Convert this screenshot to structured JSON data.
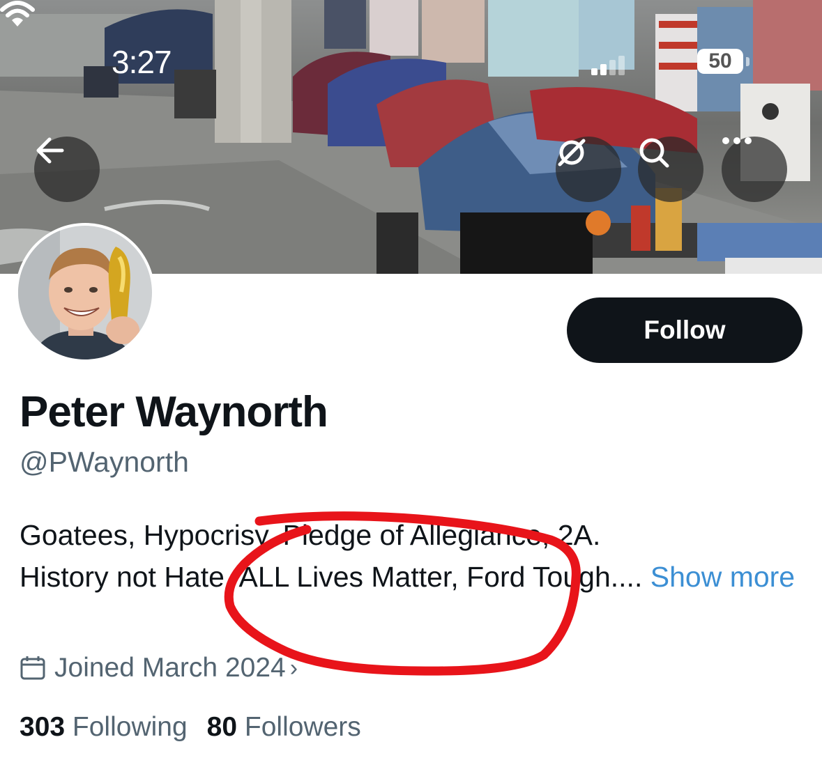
{
  "status_bar": {
    "time": "3:27",
    "battery": "50"
  },
  "profile": {
    "name": "Peter Waynorth",
    "handle": "@PWaynorth",
    "follow_label": "Follow",
    "bio_line1": "Goatees, Hypocrisy, Pledge of Allegiance, 2A.",
    "bio_line2": "History not Hate, ALL Lives Matter, Ford Tough....",
    "show_more": "Show more",
    "joined": "Joined March 2024",
    "following_count": "303",
    "following_label": "Following",
    "followers_count": "80",
    "followers_label": "Followers"
  },
  "icons": {
    "back": "arrow-left-icon",
    "grok": "grok-icon",
    "search": "search-icon",
    "more": "more-icon",
    "calendar": "calendar-icon"
  },
  "colors": {
    "accent": "#3c8fd4",
    "button": "#0f1419",
    "scribble": "#e8141a"
  }
}
